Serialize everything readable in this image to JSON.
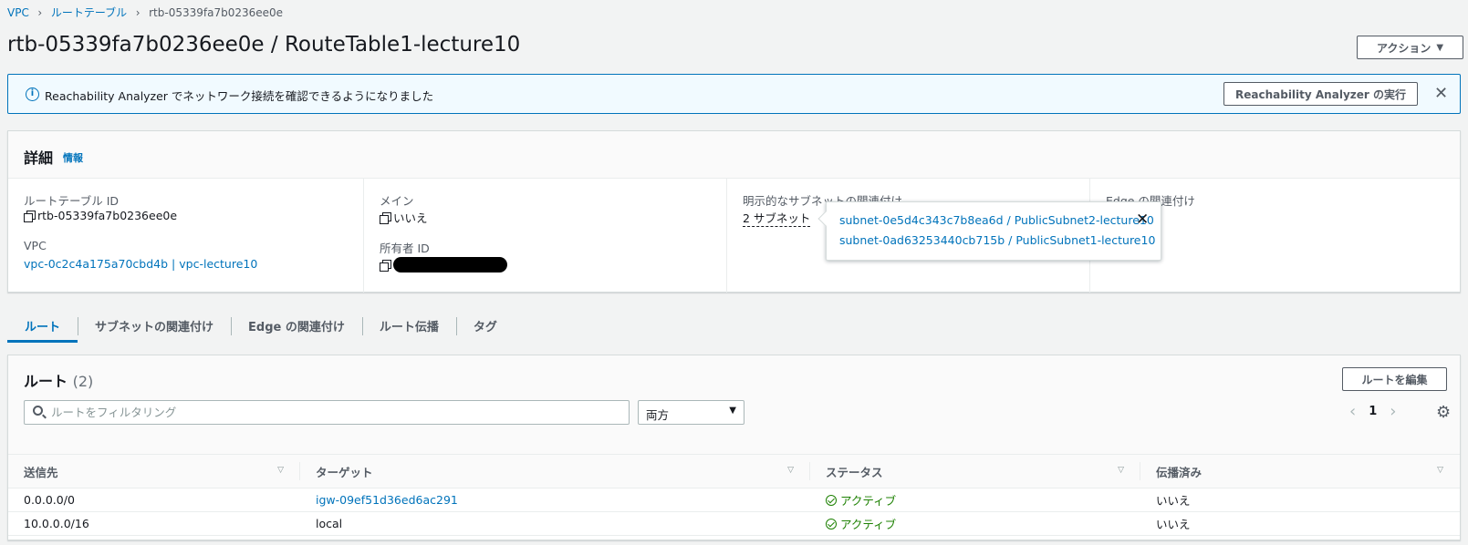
{
  "breadcrumb": {
    "items": [
      "VPC",
      "ルートテーブル"
    ],
    "current": "rtb-05339fa7b0236ee0e"
  },
  "page": {
    "title": "rtb-05339fa7b0236ee0e / RouteTable1-lecture10",
    "action_button": "アクション"
  },
  "flash": {
    "message": "Reachability Analyzer でネットワーク接続を確認できるようになりました",
    "button": "Reachability Analyzer の実行"
  },
  "details": {
    "title": "詳細",
    "info_link": "情報",
    "route_table_id_label": "ルートテーブル ID",
    "route_table_id": "rtb-05339fa7b0236ee0e",
    "vpc_label": "VPC",
    "vpc_link": "vpc-0c2c4a175a70cbd4b",
    "vpc_sep": "|",
    "vpc_name": "vpc-lecture10",
    "main_label": "メイン",
    "main_value": "いいえ",
    "owner_label": "所有者 ID",
    "subnet_assoc_label": "明示的なサブネットの関連付け",
    "subnet_assoc_value": "2 サブネット",
    "edge_assoc_label": "Edge の関連付け"
  },
  "popover": {
    "items": [
      "subnet-0e5d4c343c7b8ea6d / PublicSubnet2-lecture10",
      "subnet-0ad63253440cb715b / PublicSubnet1-lecture10"
    ]
  },
  "tabs": [
    {
      "label": "ルート",
      "active": true
    },
    {
      "label": "サブネットの関連付け",
      "active": false
    },
    {
      "label": "Edge の関連付け",
      "active": false
    },
    {
      "label": "ルート伝播",
      "active": false
    },
    {
      "label": "タグ",
      "active": false
    }
  ],
  "routes": {
    "title": "ルート",
    "count": "(2)",
    "edit_button": "ルートを編集",
    "search_placeholder": "ルートをフィルタリング",
    "select_value": "両方",
    "page_number": "1",
    "columns": [
      "送信先",
      "ターゲット",
      "ステータス",
      "伝播済み"
    ],
    "rows": [
      {
        "destination": "0.0.0.0/0",
        "target": "igw-09ef51d36ed6ac291",
        "target_is_link": true,
        "status": "アクティブ",
        "propagated": "いいえ"
      },
      {
        "destination": "10.0.0.0/16",
        "target": "local",
        "target_is_link": false,
        "status": "アクティブ",
        "propagated": "いいえ"
      }
    ]
  },
  "colors": {
    "link": "#0073bb",
    "success": "#1d8102",
    "info_bg": "#f1faff"
  }
}
